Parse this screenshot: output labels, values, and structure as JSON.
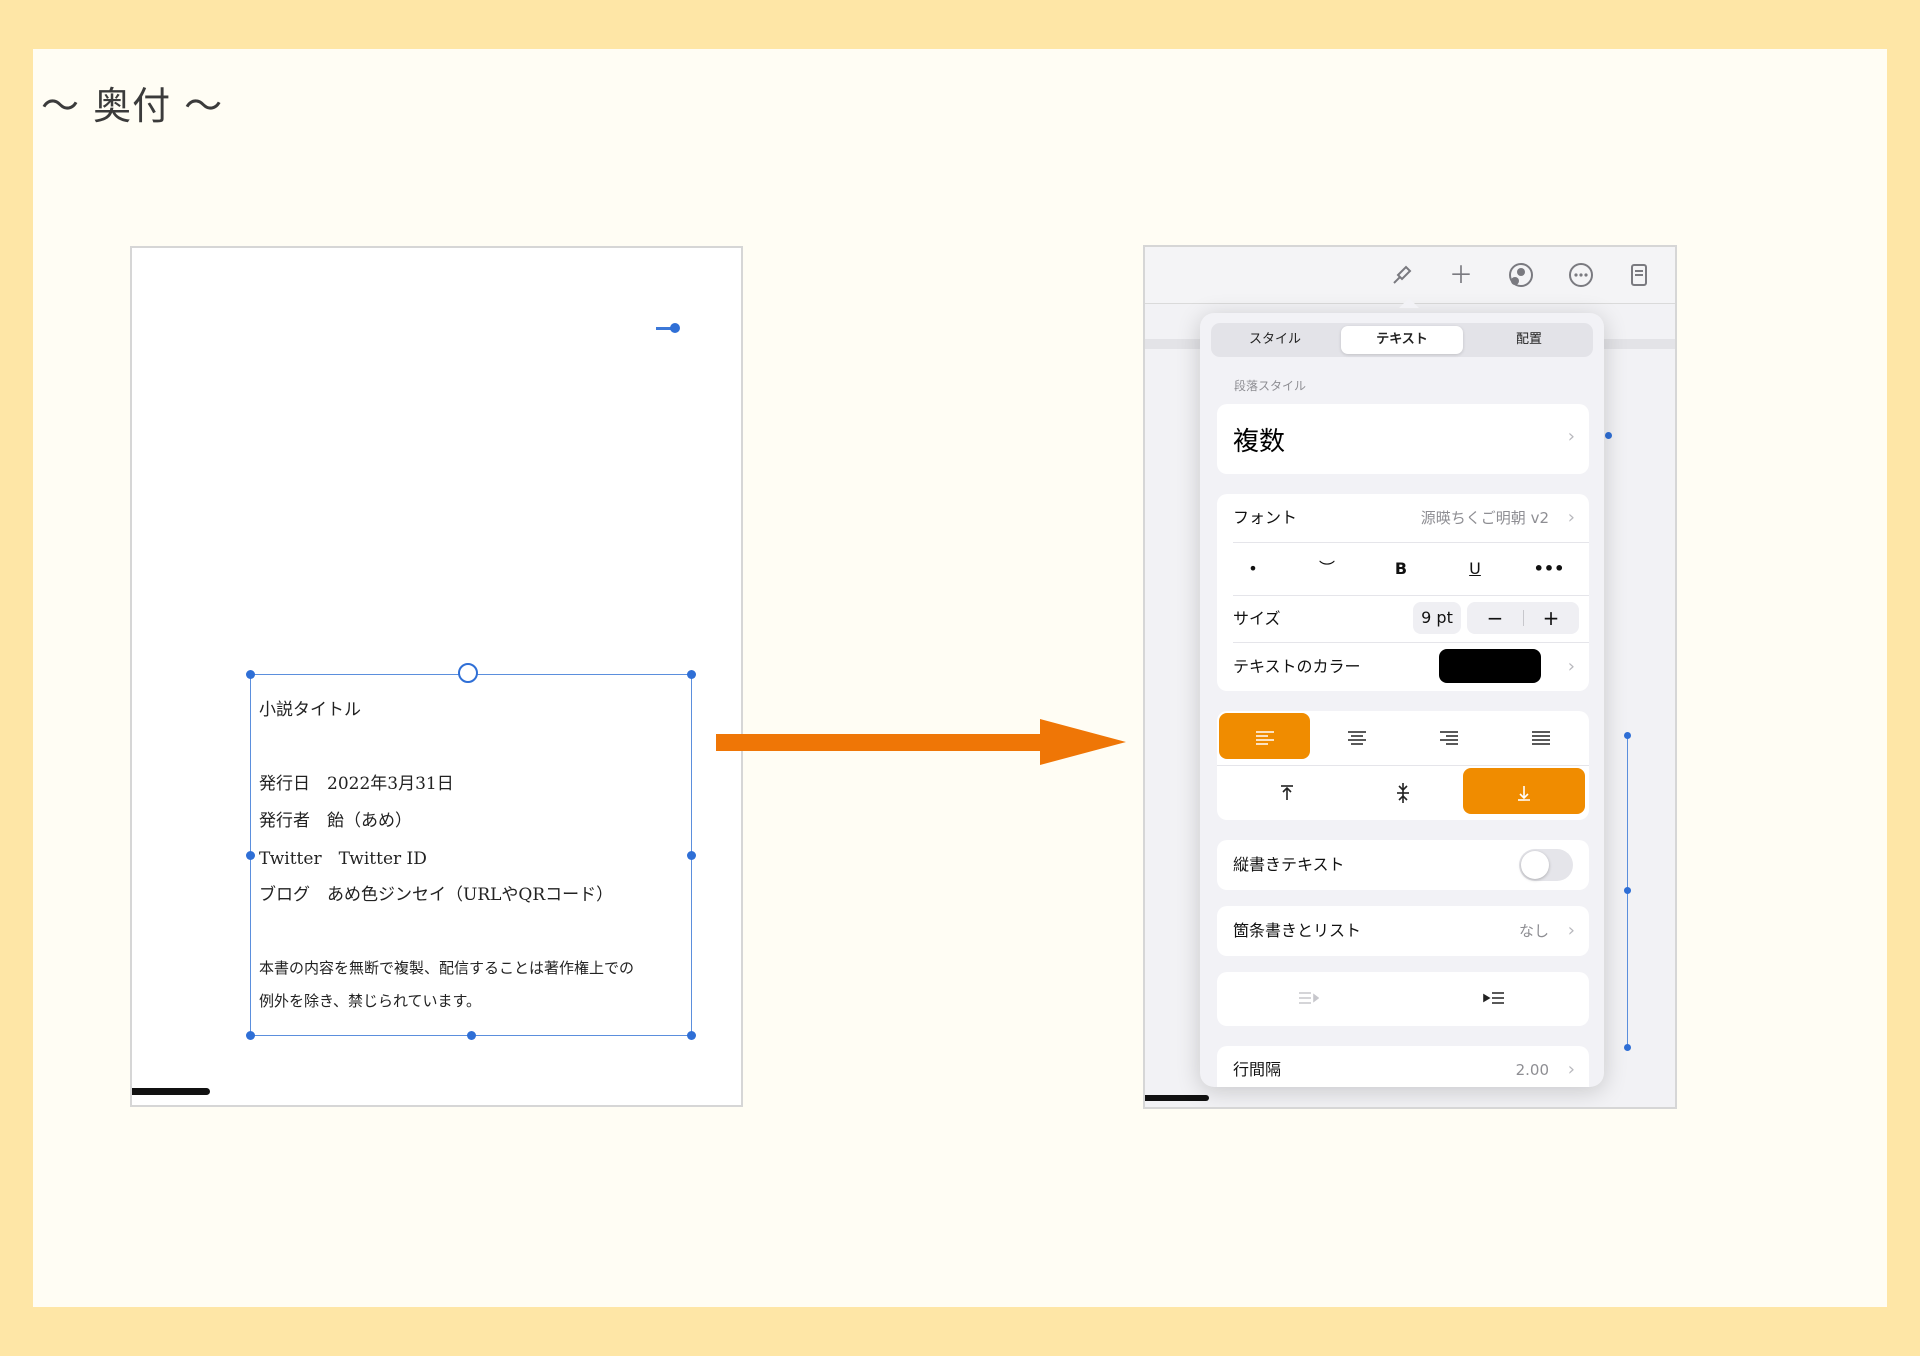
{
  "heading": "〜 奥付 〜",
  "colors": {
    "frame": "#fee6a6",
    "canvas": "#fffdf4",
    "accent_orange": "#f08c00",
    "arrow_orange": "#ef7606",
    "selection_blue": "#2f6fd6"
  },
  "left_page": {
    "textbox_lines": {
      "title": "小説タイトル",
      "date": "発行日　2022年3月31日",
      "publisher": "発行者　飴（あめ）",
      "twitter": "Twitter　Twitter ID",
      "blog": "ブログ　あめ色ジンセイ（URLやQRコード）",
      "notice1": "本書の内容を無断で複製、配信することは著作権上での",
      "notice2": "例外を除き、禁じられています。"
    }
  },
  "toolbar": {
    "icons": [
      "paintbrush-icon",
      "plus-icon",
      "collaborate-icon",
      "more-icon",
      "document-icon"
    ]
  },
  "popover": {
    "tabs": [
      "スタイル",
      "テキスト",
      "配置"
    ],
    "active_tab": "テキスト",
    "paragraph_style_label": "段落スタイル",
    "paragraph_style_value": "複数",
    "font_label": "フォント",
    "font_value": "源暎ちくご明朝 v2",
    "format_buttons": [
      "•",
      "︶",
      "B",
      "U",
      "•••"
    ],
    "size_label": "サイズ",
    "size_value": "9 pt",
    "size_minus": "−",
    "size_plus": "+",
    "text_color_label": "テキストのカラー",
    "text_color": "#000000",
    "horizontal_align": [
      "left",
      "center",
      "right",
      "justify"
    ],
    "horizontal_align_active": "left",
    "vertical_align": [
      "top",
      "middle",
      "bottom"
    ],
    "vertical_align_active": "bottom",
    "vertical_text_label": "縦書きテキスト",
    "vertical_text_on": false,
    "bullets_label": "箇条書きとリスト",
    "bullets_value": "なし",
    "line_spacing_label": "行間隔",
    "line_spacing_value": "2.00"
  }
}
